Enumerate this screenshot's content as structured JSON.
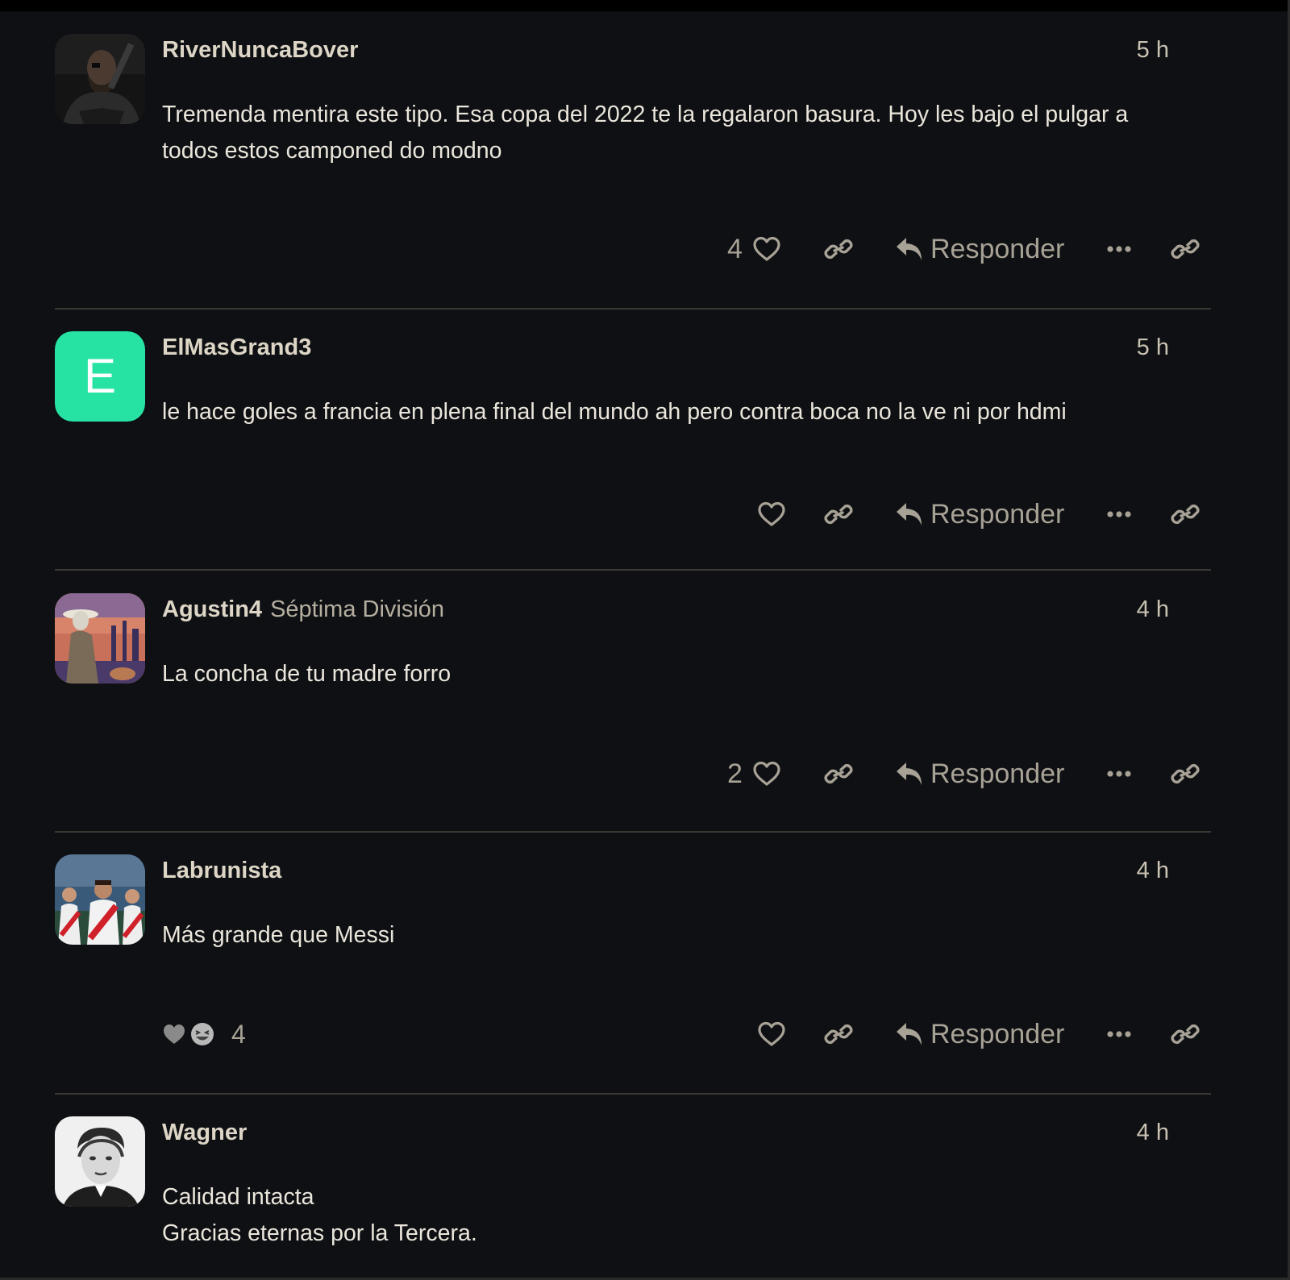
{
  "posts": [
    {
      "username": "RiverNuncaBover",
      "user_title": "",
      "time": "5 h",
      "lines": [
        "Tremenda mentira este tipo. Esa copa del 2022 te la regalaron basura. Hoy les bajo el pulgar a",
        "todos estos camponed do modno"
      ],
      "like_count": "4",
      "reply_label": "Responder"
    },
    {
      "username": "ElMasGrand3",
      "user_title": "",
      "time": "5 h",
      "avatar_letter": "E",
      "avatar_color": "#27e3a3",
      "lines": [
        "le hace goles a francia en plena final del mundo ah pero contra boca no la ve ni por hdmi"
      ],
      "like_count": "",
      "reply_label": "Responder"
    },
    {
      "username": "Agustin4",
      "user_title": "Séptima División",
      "time": "4 h",
      "lines": [
        "La concha de tu madre forro"
      ],
      "like_count": "2",
      "reply_label": "Responder"
    },
    {
      "username": "Labrunista",
      "user_title": "",
      "time": "4 h",
      "lines": [
        "Más grande que Messi"
      ],
      "like_count": "",
      "reaction_count": "4",
      "reply_label": "Responder"
    },
    {
      "username": "Wagner",
      "user_title": "",
      "time": "4 h",
      "lines": [
        "Calidad intacta",
        "Gracias eternas por la Tercera."
      ]
    }
  ]
}
